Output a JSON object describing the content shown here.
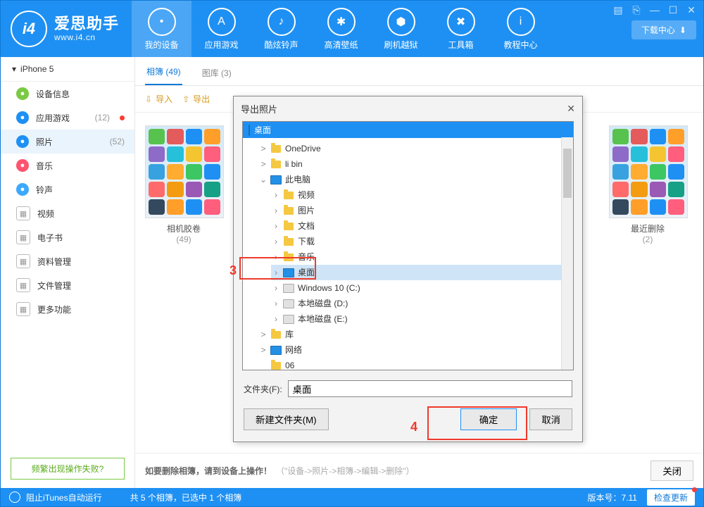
{
  "brand": {
    "title": "爱思助手",
    "url": "www.i4.cn",
    "logo_text": "i4"
  },
  "nav": {
    "download": "下载中心",
    "items": [
      {
        "k": "device",
        "label": "我的设备"
      },
      {
        "k": "apps",
        "label": "应用游戏"
      },
      {
        "k": "ringtones",
        "label": "酷炫铃声"
      },
      {
        "k": "wallpapers",
        "label": "高清壁纸"
      },
      {
        "k": "flash",
        "label": "刷机越狱"
      },
      {
        "k": "tools",
        "label": "工具箱"
      },
      {
        "k": "tutorial",
        "label": "教程中心"
      }
    ]
  },
  "device": {
    "name": "iPhone 5"
  },
  "menu": [
    {
      "k": "info",
      "label": "设备信息",
      "color": "#7ac943"
    },
    {
      "k": "apps",
      "label": "应用游戏",
      "count": "(12)",
      "dot": true,
      "color": "#1e90f3"
    },
    {
      "k": "photos",
      "label": "照片",
      "count": "(52)",
      "sel": true,
      "color": "#1e90f3"
    },
    {
      "k": "music",
      "label": "音乐",
      "color": "#ff5370"
    },
    {
      "k": "ring",
      "label": "铃声",
      "color": "#3da9fc"
    },
    {
      "k": "video",
      "label": "视频",
      "sq": true
    },
    {
      "k": "ebook",
      "label": "电子书",
      "sq": true
    },
    {
      "k": "data",
      "label": "资料管理",
      "sq": true
    },
    {
      "k": "file",
      "label": "文件管理",
      "sq": true
    },
    {
      "k": "more",
      "label": "更多功能",
      "sq": true
    }
  ],
  "side_link": "频繁出现操作失败?",
  "tabs": [
    {
      "label": "相簿 (49)",
      "active": true
    },
    {
      "label": "图库 (3)"
    }
  ],
  "toolbar": {
    "import": "导入",
    "export": "导出"
  },
  "albums": [
    {
      "name": "相机胶卷",
      "count": "(49)"
    },
    {
      "name": "最近删除",
      "count": "(2)"
    }
  ],
  "hint": {
    "main": "如要删除相簿，请到设备上操作！",
    "path": "（\"设备->照片->相簿->编辑->删除\"）",
    "close": "关闭"
  },
  "status": {
    "left": "阻止iTunes自动运行",
    "mid": "共 5 个相簿，已选中 1 个相簿",
    "version_label": "版本号：",
    "version": "7.11",
    "update": "检查更新"
  },
  "modal": {
    "title": "导出照片",
    "root": "桌面",
    "tree": {
      "top": [
        {
          "t": "OneDrive",
          "exp": ">",
          "ico": "cloud"
        },
        {
          "t": "li bin",
          "exp": ">",
          "ico": "folder"
        }
      ],
      "pc_label": "此电脑",
      "pc": [
        {
          "t": "视频",
          "ico": "video"
        },
        {
          "t": "图片",
          "ico": "pic"
        },
        {
          "t": "文档",
          "ico": "doc"
        },
        {
          "t": "下载",
          "ico": "dl"
        },
        {
          "t": "音乐",
          "ico": "music"
        },
        {
          "t": "桌面",
          "ico": "desktop",
          "sel": true
        },
        {
          "t": "Windows 10 (C:)",
          "ico": "disk"
        },
        {
          "t": "本地磁盘 (D:)",
          "ico": "disk"
        },
        {
          "t": "本地磁盘 (E:)",
          "ico": "disk"
        }
      ],
      "bottom": [
        {
          "t": "库",
          "exp": ">",
          "ico": "folder"
        },
        {
          "t": "网络",
          "exp": ">",
          "ico": "net"
        },
        {
          "t": "06",
          "exp": "",
          "ico": "folder"
        }
      ]
    },
    "folder_label": "文件夹(F):",
    "folder_value": "桌面",
    "new_folder": "新建文件夹(M)",
    "ok": "确定",
    "cancel": "取消"
  },
  "annotations": {
    "a3": "3",
    "a4": "4"
  },
  "ios_colors": [
    "#57c24e",
    "#e35b5b",
    "#1e90f3",
    "#ff9f2a",
    "#8e6ac9",
    "#26c0da",
    "#f4c531",
    "#ff5e7c",
    "#38a2e0",
    "#ffac31",
    "#3cc763",
    "#1e90f3",
    "#ff6b6b",
    "#f39c12",
    "#9b59b6",
    "#16a085",
    "#34495e",
    "#ff9f2a",
    "#1e90f3",
    "#ff5e7c"
  ]
}
